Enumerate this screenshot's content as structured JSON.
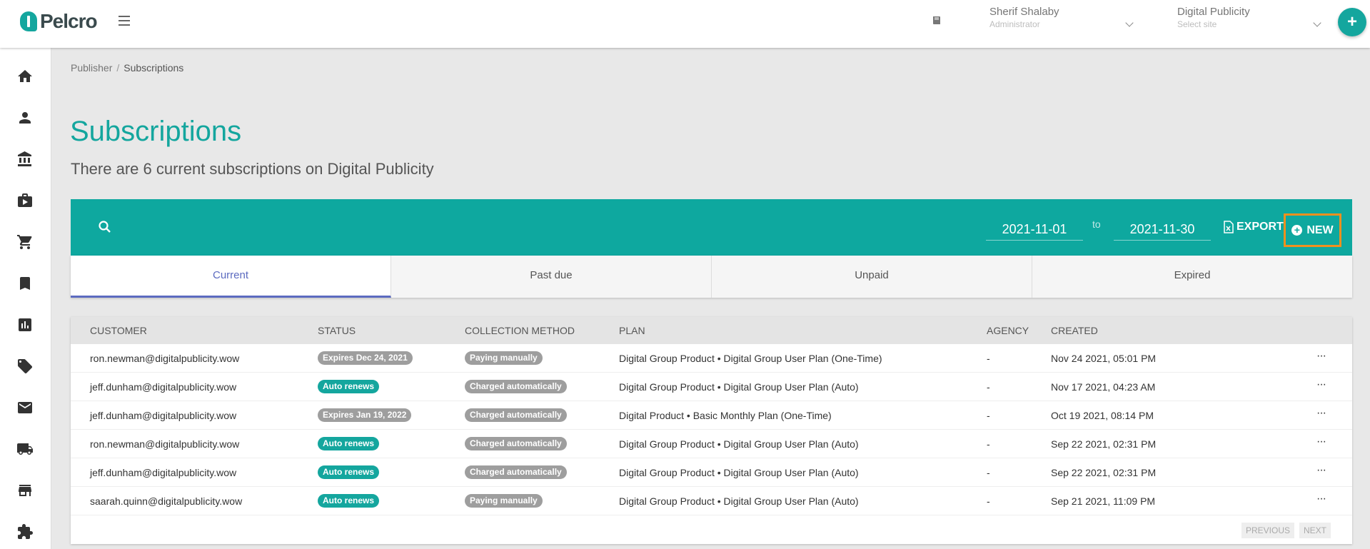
{
  "app": {
    "logo_text": "Pelcro",
    "brand_color": "#14a69e"
  },
  "header": {
    "user_name": "Sherif Shalaby",
    "user_role": "Administrator",
    "site_name": "Digital Publicity",
    "site_placeholder": "Select site",
    "fab_label": "+"
  },
  "sidebar": {
    "items": [
      {
        "icon": "home-icon"
      },
      {
        "icon": "person-icon"
      },
      {
        "icon": "bank-icon"
      },
      {
        "icon": "briefcase-icon"
      },
      {
        "icon": "cart-icon"
      },
      {
        "icon": "bookmark-icon"
      },
      {
        "icon": "chart-icon"
      },
      {
        "icon": "ticket-icon"
      },
      {
        "icon": "mail-icon"
      },
      {
        "icon": "truck-icon"
      },
      {
        "icon": "store-icon"
      },
      {
        "icon": "puzzle-icon"
      }
    ]
  },
  "breadcrumb": {
    "parent": "Publisher",
    "separator": "/",
    "current": "Subscriptions"
  },
  "page": {
    "title": "Subscriptions",
    "subtitle": "There are 6 current subscriptions on Digital Publicity"
  },
  "toolbar": {
    "date_from": "2021-11-01",
    "to_label": "to",
    "date_to": "2021-11-30",
    "export_label": "EXPORT",
    "new_label": "NEW"
  },
  "tabs": [
    {
      "label": "Current",
      "active": true
    },
    {
      "label": "Past due",
      "active": false
    },
    {
      "label": "Unpaid",
      "active": false
    },
    {
      "label": "Expired",
      "active": false
    }
  ],
  "table": {
    "columns": [
      "CUSTOMER",
      "STATUS",
      "COLLECTION METHOD",
      "PLAN",
      "AGENCY",
      "CREATED"
    ],
    "rows": [
      {
        "customer": "ron.newman@digitalpublicity.wow",
        "status": "Expires Dec 24, 2021",
        "status_color": "grey",
        "collection": "Paying manually",
        "plan": "Digital Group Product • Digital Group User Plan (One-Time)",
        "agency": "-",
        "created": "Nov 24 2021, 05:01 PM"
      },
      {
        "customer": "jeff.dunham@digitalpublicity.wow",
        "status": "Auto renews",
        "status_color": "teal",
        "collection": "Charged automatically",
        "plan": "Digital Group Product • Digital Group User Plan (Auto)",
        "agency": "-",
        "created": "Nov 17 2021, 04:23 AM"
      },
      {
        "customer": "jeff.dunham@digitalpublicity.wow",
        "status": "Expires Jan 19, 2022",
        "status_color": "grey",
        "collection": "Charged automatically",
        "plan": "Digital Product • Basic Monthly Plan (One-Time)",
        "agency": "-",
        "created": "Oct 19 2021, 08:14 PM"
      },
      {
        "customer": "ron.newman@digitalpublicity.wow",
        "status": "Auto renews",
        "status_color": "teal",
        "collection": "Charged automatically",
        "plan": "Digital Group Product • Digital Group User Plan (Auto)",
        "agency": "-",
        "created": "Sep 22 2021, 02:31 PM"
      },
      {
        "customer": "jeff.dunham@digitalpublicity.wow",
        "status": "Auto renews",
        "status_color": "teal",
        "collection": "Charged automatically",
        "plan": "Digital Group Product • Digital Group User Plan (Auto)",
        "agency": "-",
        "created": "Sep 22 2021, 02:31 PM"
      },
      {
        "customer": "saarah.quinn@digitalpublicity.wow",
        "status": "Auto renews",
        "status_color": "teal",
        "collection": "Paying manually",
        "plan": "Digital Group Product • Digital Group User Plan (Auto)",
        "agency": "-",
        "created": "Sep 21 2021, 11:09 PM"
      }
    ],
    "row_menu": "···",
    "pagination": {
      "previous": "PREVIOUS",
      "next": "NEXT"
    }
  }
}
